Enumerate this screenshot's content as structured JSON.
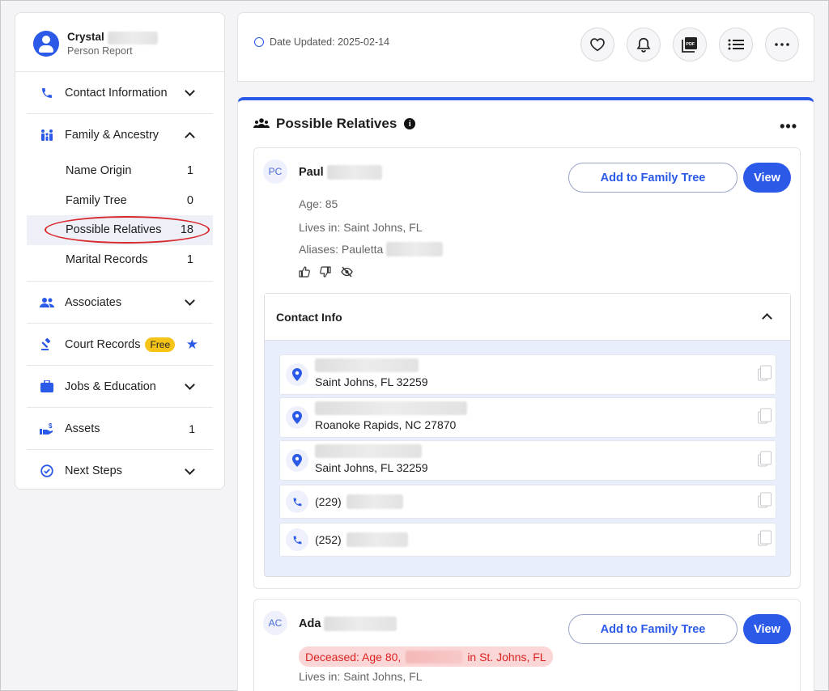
{
  "sidebar": {
    "profile": {
      "first_name": "Crystal",
      "subtitle": "Person Report"
    },
    "items": [
      {
        "label": "Contact Information",
        "icon": "phone-icon"
      },
      {
        "label": "Family & Ancestry",
        "icon": "family-icon"
      },
      {
        "label": "Associates",
        "icon": "people-icon"
      },
      {
        "label": "Court Records",
        "icon": "gavel-icon",
        "badge": "Free"
      },
      {
        "label": "Jobs & Education",
        "icon": "briefcase-icon"
      },
      {
        "label": "Assets",
        "icon": "money-icon",
        "count": "1"
      },
      {
        "label": "Next Steps",
        "icon": "check-circle-icon"
      }
    ],
    "family_sub": [
      {
        "label": "Name Origin",
        "count": "1"
      },
      {
        "label": "Family Tree",
        "count": "0"
      },
      {
        "label": "Possible Relatives",
        "count": "18"
      },
      {
        "label": "Marital Records",
        "count": "1"
      }
    ]
  },
  "header": {
    "date_updated": "Date Updated: 2025-02-14",
    "pdf_label": "PDF"
  },
  "section": {
    "title": "Possible Relatives"
  },
  "relatives": [
    {
      "initials": "PC",
      "name": "Paul",
      "age": "Age: 85",
      "lives_in": "Lives in: Saint Johns, FL",
      "aliases": "Aliases: Pauletta",
      "add_label": "Add to Family Tree",
      "view_label": "View",
      "contact": {
        "title": "Contact Info",
        "rows": [
          {
            "type": "address",
            "text": "Saint Johns, FL 32259"
          },
          {
            "type": "address",
            "text": "Roanoke Rapids, NC 27870"
          },
          {
            "type": "address",
            "text": "Saint Johns, FL 32259"
          },
          {
            "type": "phone",
            "text": "(229)"
          },
          {
            "type": "phone",
            "text": "(252)"
          }
        ]
      }
    },
    {
      "initials": "AC",
      "name": "Ada",
      "deceased_prefix": "Deceased: Age 80,",
      "deceased_suffix": "in St. Johns, FL",
      "lives_in": "Lives in: Saint Johns, FL",
      "add_label": "Add to Family Tree",
      "view_label": "View"
    }
  ],
  "colors": {
    "accent": "#2b59e8",
    "badge": "#f6c319",
    "deceased_bg": "#fbd6d6",
    "deceased_text": "#dd2222",
    "annotation": "#d9292d"
  }
}
